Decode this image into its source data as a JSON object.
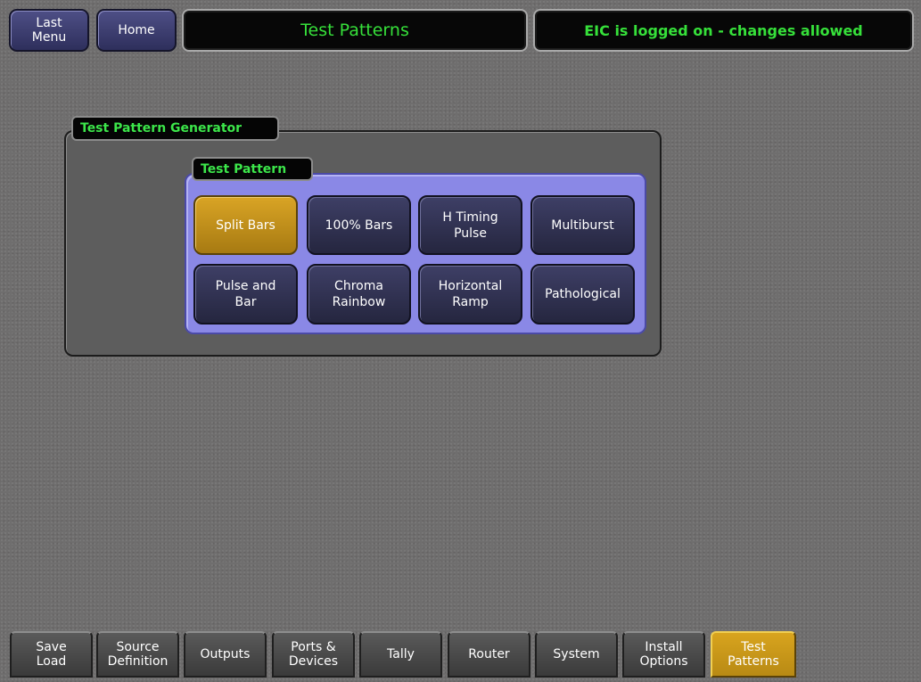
{
  "header": {
    "last_menu": "Last\nMenu",
    "home": "Home",
    "title": "Test Patterns",
    "status": "EIC is logged on - changes allowed"
  },
  "generator": {
    "label": "Test Pattern Generator",
    "pattern_label": "Test Pattern",
    "buttons": [
      {
        "label": "Split Bars",
        "selected": true
      },
      {
        "label": "100% Bars",
        "selected": false
      },
      {
        "label": "H Timing\nPulse",
        "selected": false
      },
      {
        "label": "Multiburst",
        "selected": false
      },
      {
        "label": "Pulse and\nBar",
        "selected": false
      },
      {
        "label": "Chroma\nRainbow",
        "selected": false
      },
      {
        "label": "Horizontal\nRamp",
        "selected": false
      },
      {
        "label": "Pathological",
        "selected": false
      }
    ]
  },
  "tabs": [
    {
      "label": "Save\nLoad",
      "active": false
    },
    {
      "label": "Source\nDefinition",
      "active": false
    },
    {
      "label": "Outputs",
      "active": false
    },
    {
      "label": "Ports &\nDevices",
      "active": false
    },
    {
      "label": "Tally",
      "active": false
    },
    {
      "label": "Router",
      "active": false
    },
    {
      "label": "System",
      "active": false
    },
    {
      "label": "Install\nOptions",
      "active": false
    },
    {
      "label": "Test\nPatterns",
      "active": true
    }
  ],
  "colors": {
    "accent_gold": "#d8a41e",
    "status_green": "#36e03a",
    "panel_blue": "#8a88e6",
    "button_navy": "#2e2f5c"
  }
}
